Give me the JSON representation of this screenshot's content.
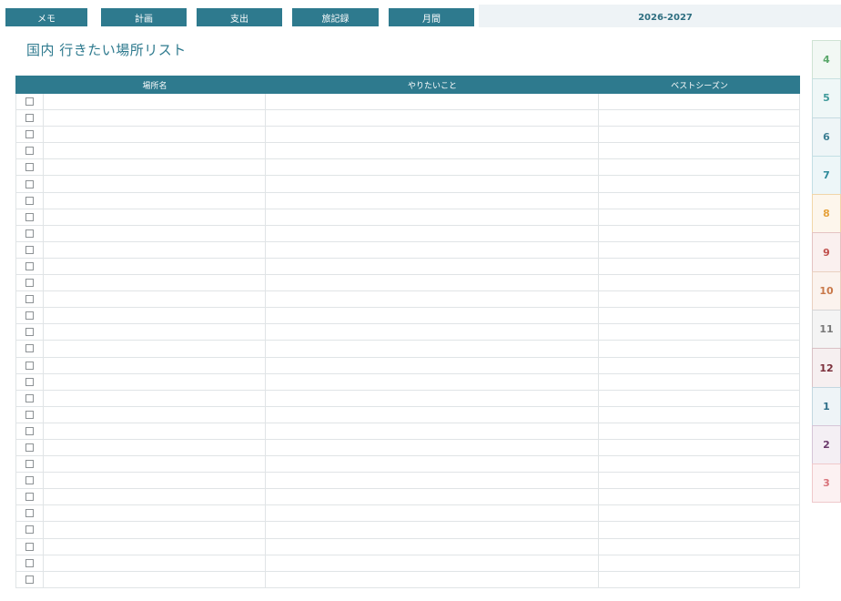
{
  "nav": {
    "buttons": [
      {
        "label": "メモ"
      },
      {
        "label": "計画"
      },
      {
        "label": "支出"
      },
      {
        "label": "旅記録"
      },
      {
        "label": "月間"
      }
    ],
    "year_range": "2026-2027"
  },
  "page": {
    "title": "国内 行きたい場所リスト"
  },
  "table": {
    "columns": [
      "場所名",
      "やりたいこと",
      "ベストシーズン"
    ],
    "row_count": 30
  },
  "month_tabs": [
    {
      "label": "4",
      "text_color": "#5aa76a",
      "bg": "#f2f8f4",
      "border": "#cfe3d4"
    },
    {
      "label": "5",
      "text_color": "#3f9a9a",
      "bg": "#eff7f7",
      "border": "#c8e1e1"
    },
    {
      "label": "6",
      "text_color": "#3c7f93",
      "bg": "#eef5f7",
      "border": "#c6dbe1"
    },
    {
      "label": "7",
      "text_color": "#2e8a9a",
      "bg": "#edf6f8",
      "border": "#c3dfe4"
    },
    {
      "label": "8",
      "text_color": "#e6a23c",
      "bg": "#fdf6ec",
      "border": "#f1d6a9"
    },
    {
      "label": "9",
      "text_color": "#c0504d",
      "bg": "#faf0ef",
      "border": "#e4c3c2"
    },
    {
      "label": "10",
      "text_color": "#c9794a",
      "bg": "#fbf3ee",
      "border": "#ead0c0"
    },
    {
      "label": "11",
      "text_color": "#777777",
      "bg": "#f4f4f4",
      "border": "#d6d6d6"
    },
    {
      "label": "12",
      "text_color": "#7b2e3a",
      "bg": "#f6eff0",
      "border": "#d9c1c5"
    },
    {
      "label": "1",
      "text_color": "#2e6e88",
      "bg": "#eef4f7",
      "border": "#c3d7e0"
    },
    {
      "label": "2",
      "text_color": "#6a3a6b",
      "bg": "#f4eff4",
      "border": "#d6c5d7"
    },
    {
      "label": "3",
      "text_color": "#d9727a",
      "bg": "#fcf1f2",
      "border": "#efc8cb"
    }
  ]
}
